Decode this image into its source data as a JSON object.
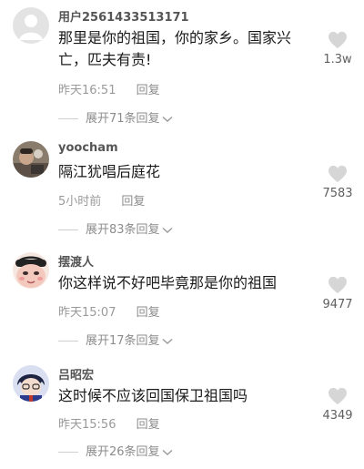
{
  "comments": [
    {
      "username": "用户2561433513171",
      "content": "那里是你的祖国，你的家乡。国家兴亡，匹夫有责!",
      "time": "昨天16:51",
      "reply": "回复",
      "expand": "展开71条回复",
      "likes": "1.3w",
      "avatar": "default-user-avatar"
    },
    {
      "username": "yoocham",
      "content": "隔江犹唱后庭花",
      "time": "5小时前",
      "reply": "回复",
      "expand": "展开83条回复",
      "likes": "7583",
      "avatar": "photo-avatar"
    },
    {
      "username": "摆渡人",
      "content": "你这样说不好吧毕竟那是你的祖国",
      "time": "昨天15:07",
      "reply": "回复",
      "expand": "展开17条回复",
      "likes": "9477",
      "avatar": "cartoon-face-avatar"
    },
    {
      "username": "吕昭宏",
      "content": "这时候不应该回国保卫祖国吗",
      "time": "昨天15:56",
      "reply": "回复",
      "expand": "展开26条回复",
      "likes": "4349",
      "avatar": "anime-character-avatar"
    }
  ],
  "icons": {
    "like": "heart-icon",
    "expand": "chevron-down-icon"
  },
  "colors": {
    "heart": "#d6d6d6",
    "meta_text": "#9a9a9a",
    "content_text": "#1a1a1a"
  }
}
